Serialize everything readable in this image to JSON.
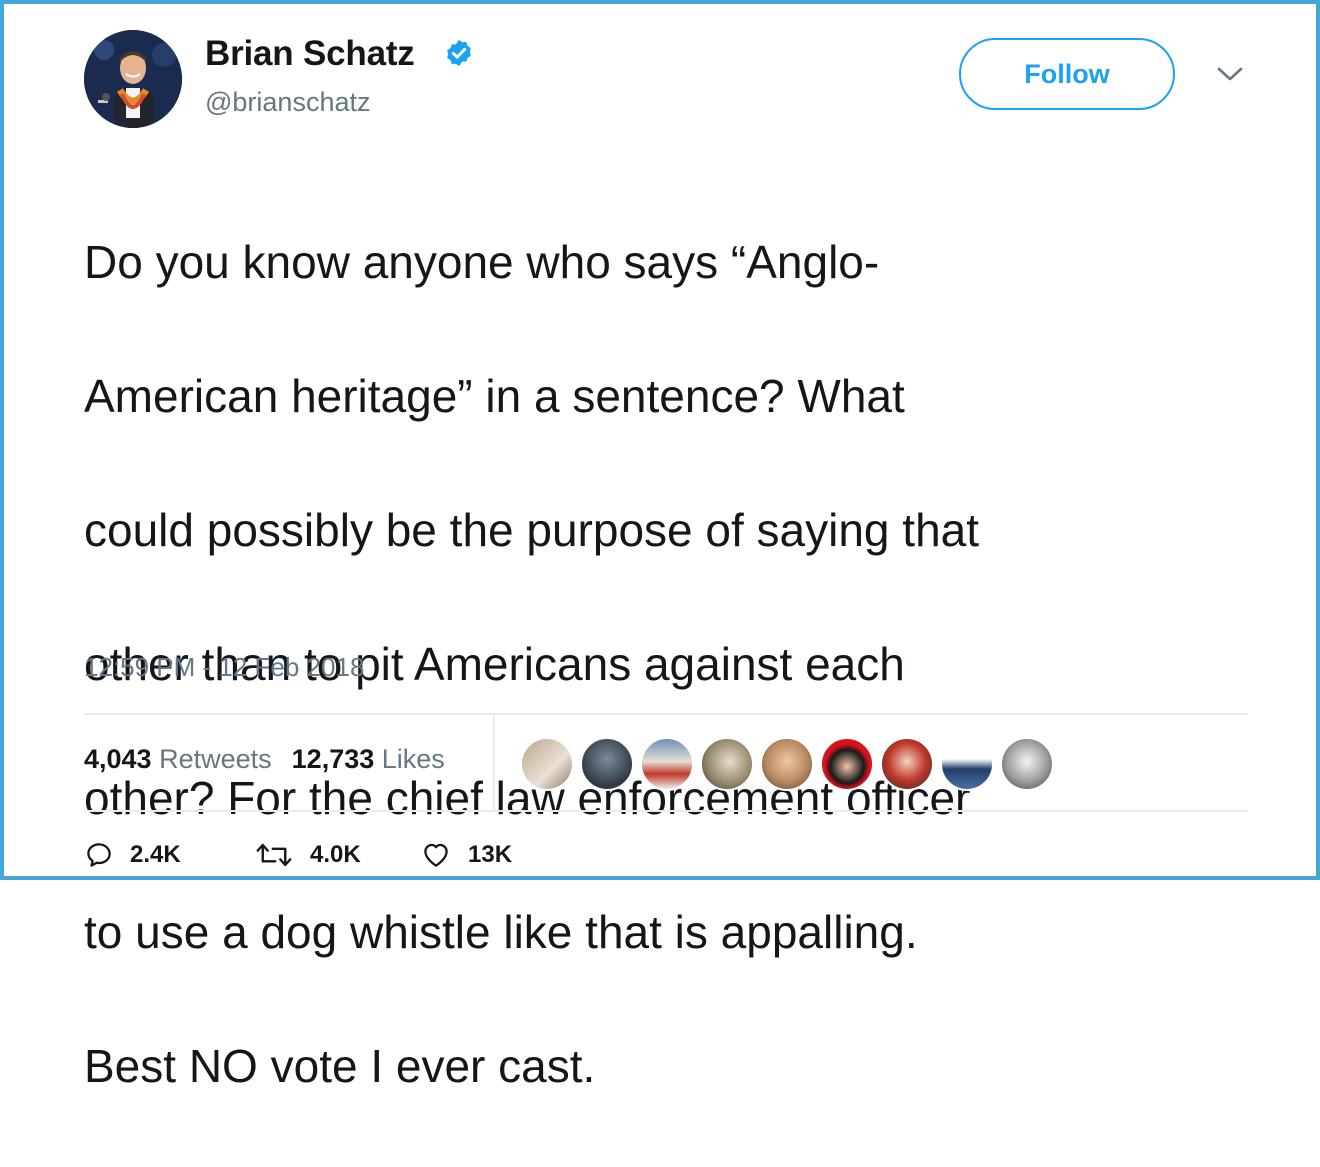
{
  "author": {
    "name": "Brian Schatz",
    "handle": "@brianschatz",
    "verified": true
  },
  "follow_button": {
    "label": "Follow"
  },
  "tweet": {
    "text_lines": [
      "Do you know anyone who says “Anglo-",
      "American heritage” in a sentence? What",
      "could possibly be the purpose of saying that",
      "other than to pit Americans against each",
      "other? For the chief law enforcement officer",
      "to use a dog whistle like that is appalling.",
      "Best NO vote I ever cast."
    ],
    "timestamp": "12:59 PM - 12 Feb 2018"
  },
  "stats": {
    "retweets_count": "4,043",
    "retweets_label": "Retweets",
    "likes_count": "12,733",
    "likes_label": "Likes"
  },
  "actions": {
    "replies": "2.4K",
    "retweets": "4.0K",
    "likes": "13K"
  },
  "colors": {
    "accent": "#1da1f2",
    "frame_border": "#45a6d8",
    "secondary_text": "#657786",
    "divider": "#e6ecf0"
  }
}
